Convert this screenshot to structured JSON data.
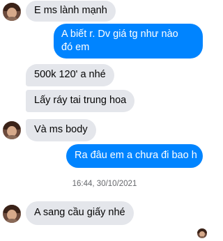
{
  "messages": [
    {
      "side": "in",
      "text": "E ms lành mạnh"
    },
    {
      "side": "out",
      "lines": [
        "A biết r. Dv giá tg như nào",
        "đó em"
      ]
    },
    {
      "side": "in",
      "text": "500k 120' a nhé"
    },
    {
      "side": "in",
      "text": "Lấy ráy tai trung hoa"
    },
    {
      "side": "in",
      "text": "Và ms body"
    },
    {
      "side": "out",
      "text": "Ra đâu em a chưa đi bao h"
    },
    {
      "side": "in",
      "text": "A sang cầu giấy nhé"
    }
  ],
  "timestamp": "16:44, 30/10/2021",
  "icons": {
    "contact_avatar": "user-avatar-icon",
    "seen_avatar": "seen-avatar-icon"
  },
  "colors": {
    "outgoing_bubble": "#0084ff",
    "incoming_bubble": "#e4e6eb",
    "timestamp_text": "#65676b"
  }
}
